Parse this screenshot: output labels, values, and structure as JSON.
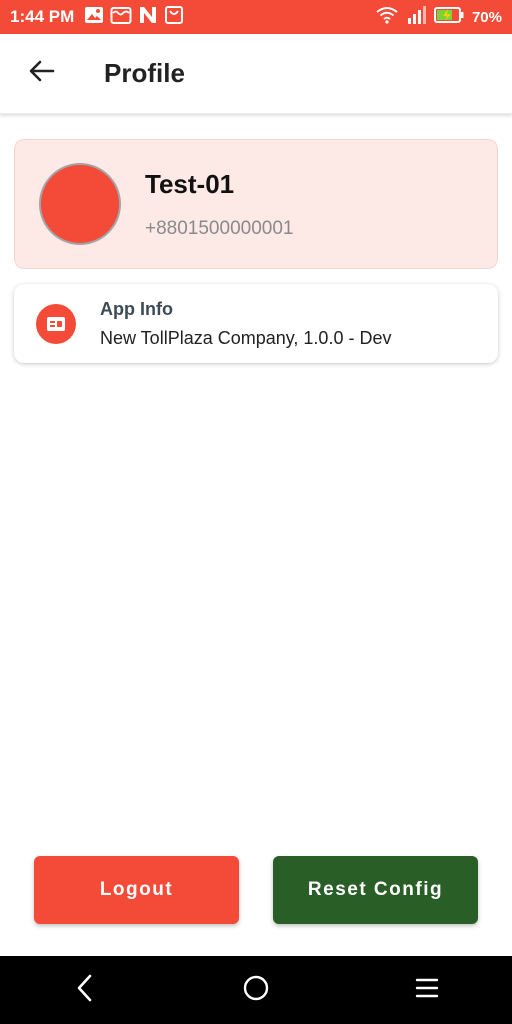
{
  "status_bar": {
    "time": "1:44 PM",
    "battery": "70%",
    "left_icons": [
      "image-icon",
      "wallet-icon",
      "n-app-icon",
      "shopping-icon"
    ],
    "right_icons": [
      "wifi-icon",
      "signal-icon",
      "battery-charging-icon"
    ],
    "color": "#f44a38"
  },
  "app_bar": {
    "title": "Profile",
    "back_icon": "arrow-left-icon"
  },
  "profile": {
    "name": "Test-01",
    "phone": "+8801500000001",
    "avatar_color": "#f44a38"
  },
  "app_info": {
    "title": "App Info",
    "subtitle": "New TollPlaza Company, 1.0.0 - Dev",
    "icon": "id-card-icon"
  },
  "actions": {
    "logout_label": "Logout",
    "reset_label": "Reset Config",
    "logout_color": "#f44a38",
    "reset_color": "#2a5e27"
  },
  "nav": [
    "back-nav-icon",
    "home-nav-icon",
    "menu-nav-icon"
  ]
}
